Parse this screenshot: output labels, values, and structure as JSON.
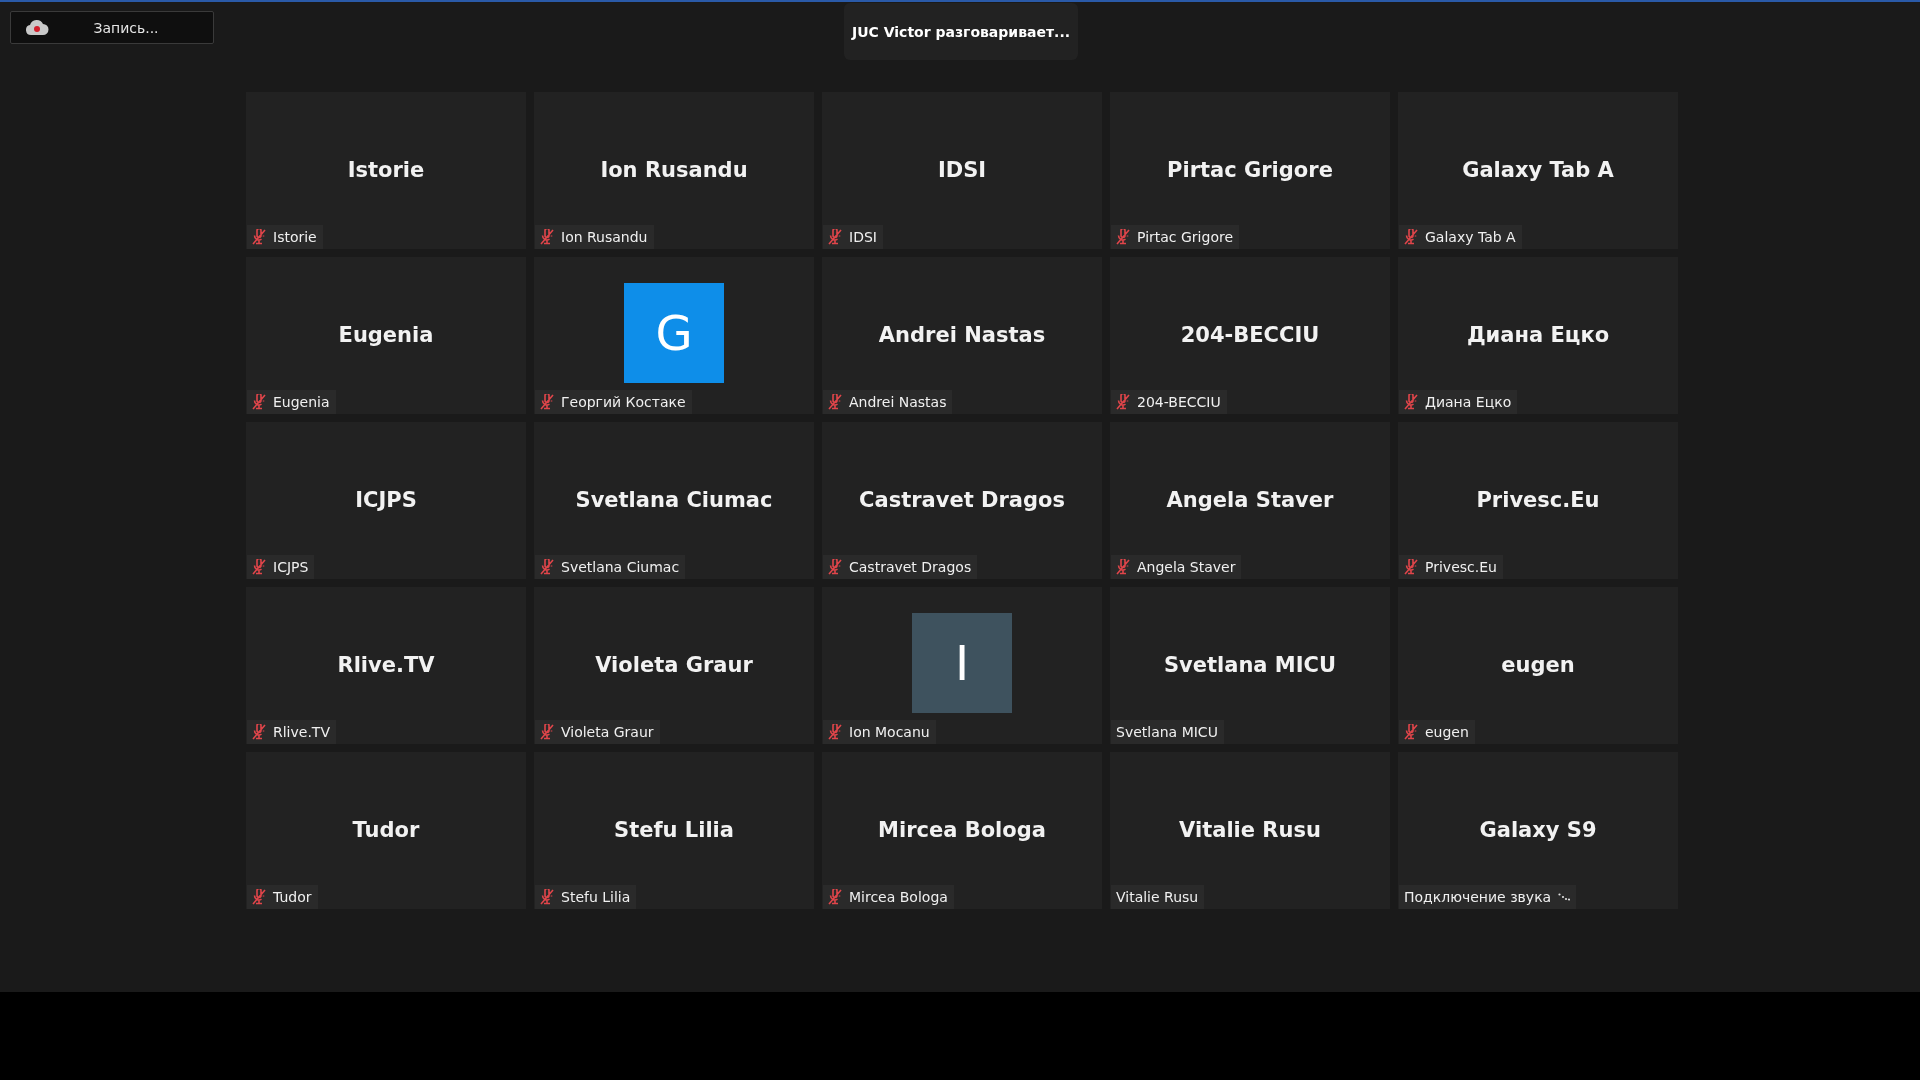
{
  "recording": {
    "label": "Запись..."
  },
  "speaker_banner": "JUC Victor разговаривает...",
  "tiles": [
    {
      "kind": "name",
      "display": "Istorie",
      "label": "Istorie",
      "muted": true,
      "connecting": false
    },
    {
      "kind": "name",
      "display": "Ion Rusandu",
      "label": "Ion Rusandu",
      "muted": true,
      "connecting": false
    },
    {
      "kind": "name",
      "display": "IDSI",
      "label": "IDSI",
      "muted": true,
      "connecting": false
    },
    {
      "kind": "name",
      "display": "Pirtac Grigore",
      "label": "Pirtac Grigore",
      "muted": true,
      "connecting": false
    },
    {
      "kind": "name",
      "display": "Galaxy Tab A",
      "label": "Galaxy Tab A",
      "muted": true,
      "connecting": false
    },
    {
      "kind": "name",
      "display": "Eugenia",
      "label": "Eugenia",
      "muted": true,
      "connecting": false
    },
    {
      "kind": "avatar",
      "display": "G",
      "color": "#0e8ee9",
      "label": "Георгий Костаке",
      "muted": true,
      "connecting": false
    },
    {
      "kind": "name",
      "display": "Andrei Nastas",
      "label": "Andrei Nastas",
      "muted": true,
      "connecting": false
    },
    {
      "kind": "name",
      "display": "204-BECCIU",
      "label": "204-BECCIU",
      "muted": true,
      "connecting": false
    },
    {
      "kind": "name",
      "display": "Диана Ецко",
      "label": "Диана Ецко",
      "muted": true,
      "connecting": false
    },
    {
      "kind": "name",
      "display": "ICJPS",
      "label": "ICJPS",
      "muted": true,
      "connecting": false
    },
    {
      "kind": "name",
      "display": "Svetlana Ciumac",
      "label": "Svetlana Ciumac",
      "muted": true,
      "connecting": false
    },
    {
      "kind": "name",
      "display": "Castravet Dragos",
      "label": "Castravet Dragos",
      "muted": true,
      "connecting": false
    },
    {
      "kind": "name",
      "display": "Angela Staver",
      "label": "Angela Staver",
      "muted": true,
      "connecting": false
    },
    {
      "kind": "name",
      "display": "Privesc.Eu",
      "label": "Privesc.Eu",
      "muted": true,
      "connecting": false
    },
    {
      "kind": "name",
      "display": "Rlive.TV",
      "label": "Rlive.TV",
      "muted": true,
      "connecting": false
    },
    {
      "kind": "name",
      "display": "Violeta Graur",
      "label": "Violeta Graur",
      "muted": true,
      "connecting": false
    },
    {
      "kind": "avatar",
      "display": "I",
      "color": "#3e525e",
      "label": "Ion Mocanu",
      "muted": true,
      "connecting": false
    },
    {
      "kind": "name",
      "display": "Svetlana MICU",
      "label": "Svetlana MICU",
      "muted": false,
      "connecting": false
    },
    {
      "kind": "name",
      "display": "eugen",
      "label": "eugen",
      "muted": true,
      "connecting": false
    },
    {
      "kind": "name",
      "display": "Tudor",
      "label": "Tudor",
      "muted": true,
      "connecting": false
    },
    {
      "kind": "name",
      "display": "Stefu Lilia",
      "label": "Stefu Lilia",
      "muted": true,
      "connecting": false
    },
    {
      "kind": "name",
      "display": "Mircea Bologa",
      "label": "Mircea Bologa",
      "muted": true,
      "connecting": false
    },
    {
      "kind": "name",
      "display": "Vitalie Rusu",
      "label": "Vitalie Rusu",
      "muted": false,
      "connecting": false
    },
    {
      "kind": "name",
      "display": "Galaxy S9",
      "label": "Подключение звука",
      "muted": false,
      "connecting": true
    }
  ]
}
